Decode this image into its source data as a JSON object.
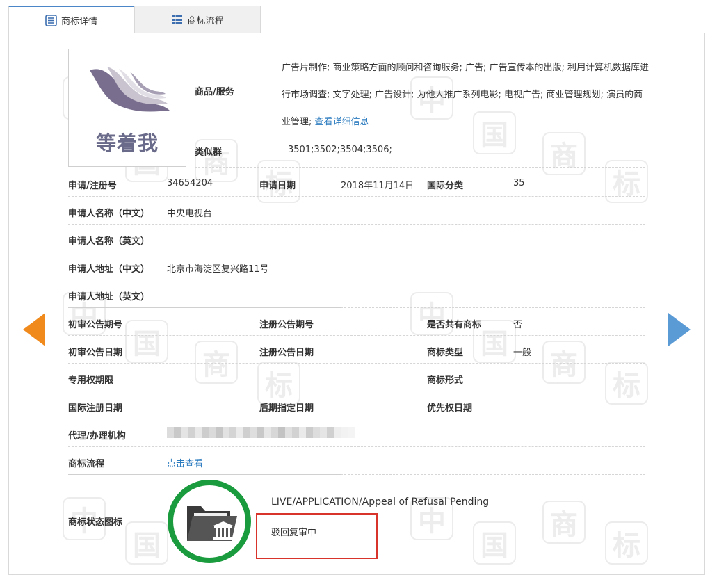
{
  "tabs": {
    "detail": "商标详情",
    "flow": "商标流程"
  },
  "watermark": {
    "chars": [
      "中",
      "国",
      "商",
      "标"
    ]
  },
  "logo": {
    "text": "等着我"
  },
  "goods": {
    "label": "商品/服务",
    "text": "广告片制作; 商业策略方面的顾问和咨询服务; 广告; 广告宣传本的出版; 利用计算机数据库进行市场调查; 文字处理; 广告设计; 为他人推广系列电影; 电视广告; 商业管理规划; 演员的商业管理;",
    "more_link": "查看详细信息"
  },
  "similar": {
    "label": "类似群",
    "value": "3501;3502;3504;3506;"
  },
  "reg": {
    "label": "申请/注册号",
    "value": "34654204",
    "date_label": "申请日期",
    "date_value": "2018年11月14日",
    "class_label": "国际分类",
    "class_value": "35"
  },
  "applicant_cn": {
    "label": "申请人名称（中文）",
    "value": "中央电视台"
  },
  "applicant_en": {
    "label": "申请人名称（英文）",
    "value": ""
  },
  "address_cn": {
    "label": "申请人地址（中文）",
    "value": "北京市海淀区复兴路11号"
  },
  "address_en": {
    "label": "申请人地址（英文）",
    "value": ""
  },
  "row_a": {
    "l1": "初审公告期号",
    "l2": "注册公告期号",
    "l3": "是否共有商标",
    "v3": "否"
  },
  "row_b": {
    "l1": "初审公告日期",
    "l2": "注册公告日期",
    "l3": "商标类型",
    "v3": "一般"
  },
  "row_c": {
    "l1": "专用权期限",
    "l3": "商标形式"
  },
  "row_d": {
    "l1": "国际注册日期",
    "l2": "后期指定日期",
    "l3": "优先权日期"
  },
  "agent": {
    "label": "代理/办理机构"
  },
  "process": {
    "label": "商标流程",
    "link": "点击查看"
  },
  "status": {
    "label": "商标状态图标",
    "en": "LIVE/APPLICATION/Appeal of Refusal Pending",
    "cn": "驳回复审中"
  },
  "colors": {
    "accent": "#2b7bbf",
    "prev_arrow": "#f08a1c",
    "next_arrow": "#5b9bd5",
    "status_ring": "#1a9b3d",
    "highlight": "#d9342b"
  }
}
